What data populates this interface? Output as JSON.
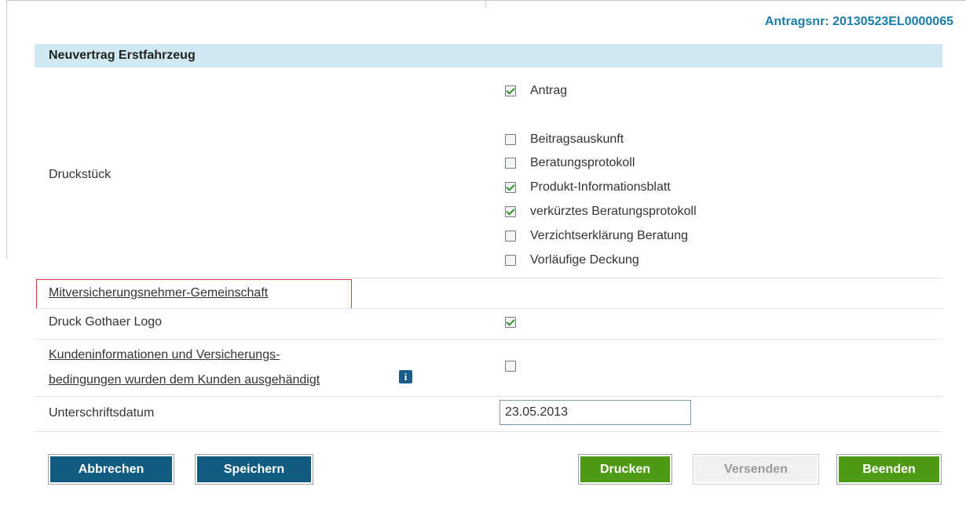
{
  "header": {
    "antrag_nr": "Antragsnr: 20130523EL0000065",
    "section_title": "Neuvertrag Erstfahrzeug"
  },
  "druckstueck": {
    "label": "Druckstück",
    "items": [
      {
        "label": "Antrag",
        "checked": true
      },
      {
        "label": "Beitragsauskunft",
        "checked": false
      },
      {
        "label": "Beratungsprotokoll",
        "checked": false
      },
      {
        "label": "Produkt-Informationsblatt",
        "checked": true
      },
      {
        "label": "verkürztes Beratungsprotokoll",
        "checked": true
      },
      {
        "label": "Verzichtserklärung Beratung",
        "checked": false
      },
      {
        "label": "Vorläufige Deckung",
        "checked": false
      }
    ]
  },
  "mitversicherung": {
    "link": "Mitversicherungsnehmer-Gemeinschaft"
  },
  "logo_row": {
    "label": "Druck Gothaer Logo",
    "checked": true
  },
  "kundeninfo_row": {
    "line1": "Kundeninformationen und Versicherungs-",
    "line2": "bedingungen wurden dem Kunden ausgehändigt",
    "info_icon": "info-icon",
    "checked": false
  },
  "signature": {
    "label": "Unterschriftsdatum",
    "value": "23.05.2013"
  },
  "buttons": {
    "cancel": "Abbrechen",
    "save": "Speichern",
    "print": "Drucken",
    "send": "Versenden",
    "finish": "Beenden"
  },
  "colors": {
    "accent": "#1a7ca8",
    "header_bg": "#cfe9f2",
    "button_blue": "#0f5c80",
    "button_green": "#4f9a14",
    "highlight": "#e23a3a"
  }
}
